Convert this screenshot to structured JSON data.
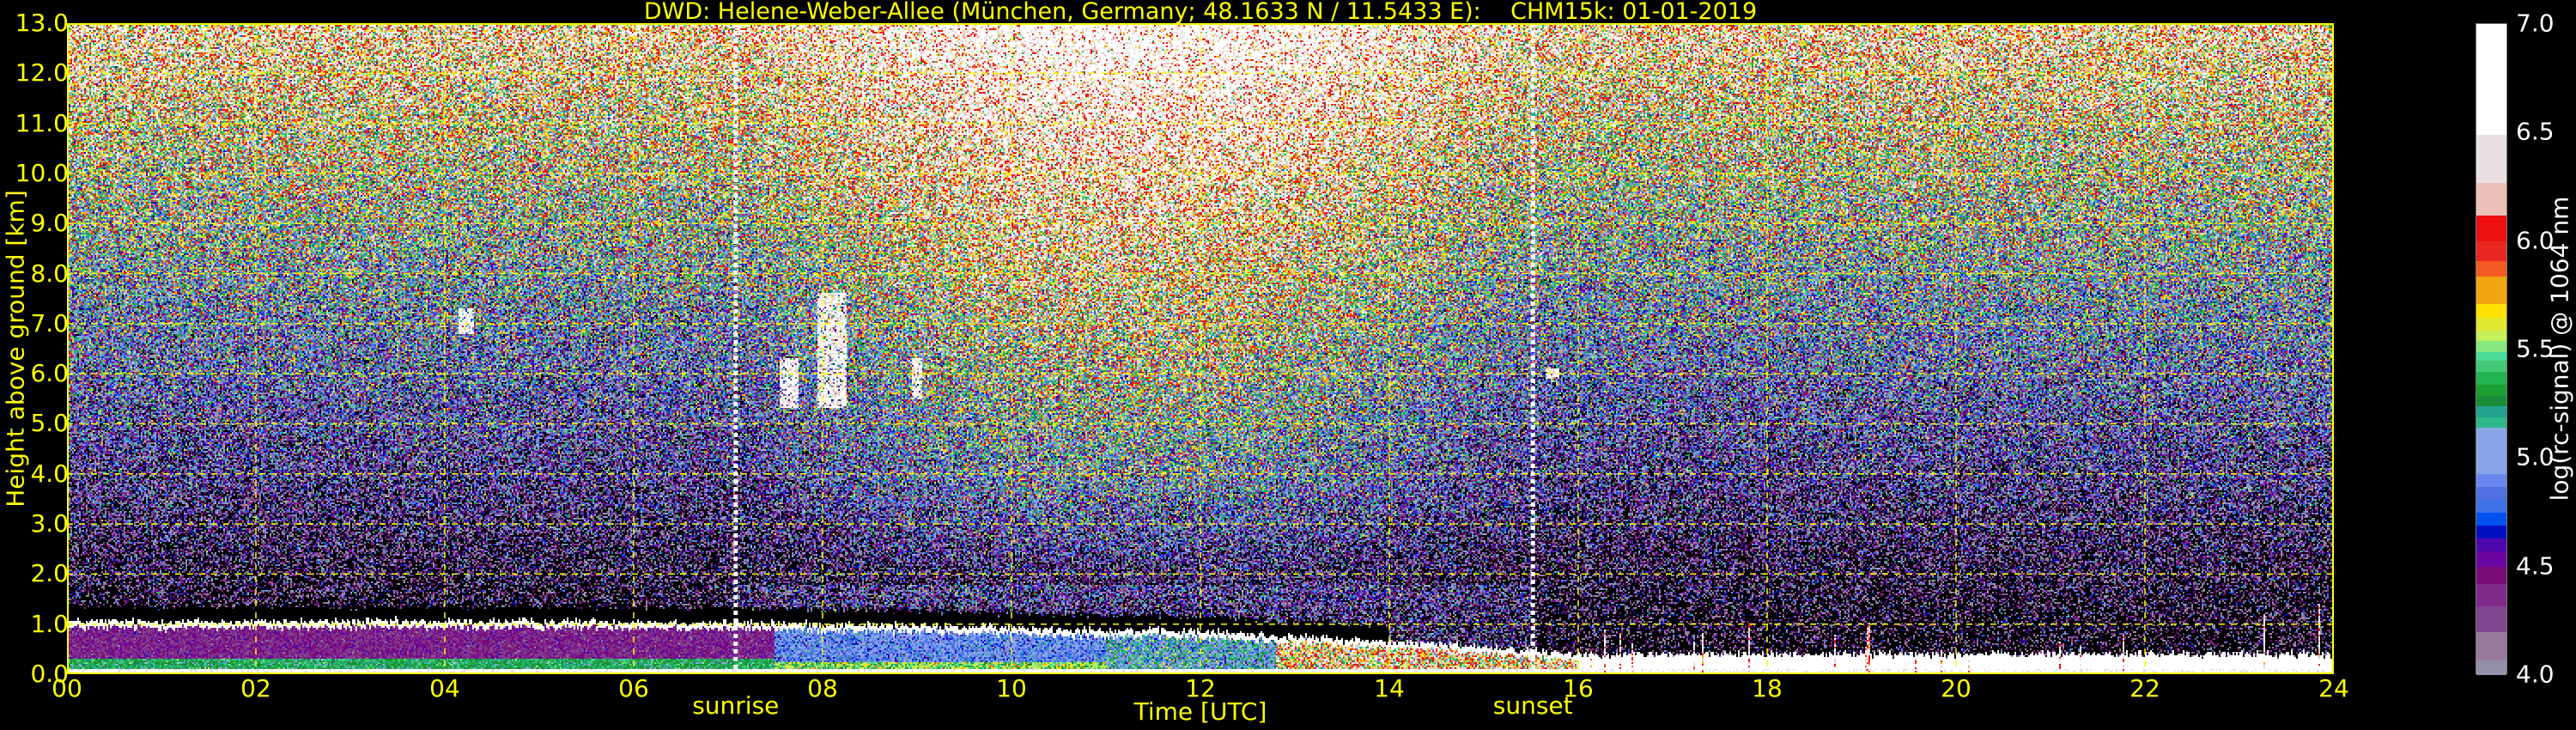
{
  "chart_data": {
    "type": "heatmap",
    "title": "DWD: Helene-Weber-Allee (München, Germany; 48.1633 N / 11.5433 E):    CHM15k: 01-01-2019",
    "xlabel": "Time [UTC]",
    "ylabel": "Height above ground [km]",
    "xlim": [
      0,
      24
    ],
    "ylim": [
      0,
      13
    ],
    "xticks": [
      "00",
      "02",
      "04",
      "06",
      "08",
      "10",
      "12",
      "14",
      "16",
      "18",
      "20",
      "22",
      "24"
    ],
    "xtick_values": [
      0,
      2,
      4,
      6,
      8,
      10,
      12,
      14,
      16,
      18,
      20,
      22,
      24
    ],
    "yticks": [
      "0.0",
      "1.0",
      "2.0",
      "3.0",
      "4.0",
      "5.0",
      "6.0",
      "7.0",
      "8.0",
      "9.0",
      "10.0",
      "11.0",
      "12.0",
      "13.0"
    ],
    "ytick_values": [
      0,
      1,
      2,
      3,
      4,
      5,
      6,
      7,
      8,
      9,
      10,
      11,
      12,
      13
    ],
    "grid": true,
    "events": [
      {
        "label": "sunrise",
        "time": 7.08
      },
      {
        "label": "sunset",
        "time": 15.52
      }
    ],
    "colorbar": {
      "label": "log(rc-signal) @ 1064 nm",
      "range": [
        4.0,
        7.0
      ],
      "ticks": [
        "4.0",
        "4.5",
        "5.0",
        "5.5",
        "6.0",
        "6.5",
        "7.0"
      ],
      "tick_values": [
        4.0,
        4.5,
        5.0,
        5.5,
        6.0,
        6.5,
        7.0
      ],
      "bins": [
        {
          "from": 4.0,
          "to": 4.07,
          "color": "#9490ac"
        },
        {
          "from": 4.07,
          "to": 4.2,
          "color": "#987a9c"
        },
        {
          "from": 4.2,
          "to": 4.32,
          "color": "#804690"
        },
        {
          "from": 4.32,
          "to": 4.42,
          "color": "#822a8a"
        },
        {
          "from": 4.42,
          "to": 4.5,
          "color": "#7a0c78"
        },
        {
          "from": 4.5,
          "to": 4.57,
          "color": "#6a06a0"
        },
        {
          "from": 4.57,
          "to": 4.63,
          "color": "#4c08ae"
        },
        {
          "from": 4.63,
          "to": 4.69,
          "color": "#0010c0"
        },
        {
          "from": 4.69,
          "to": 4.75,
          "color": "#0050f0"
        },
        {
          "from": 4.75,
          "to": 4.81,
          "color": "#3e70e8"
        },
        {
          "from": 4.81,
          "to": 4.87,
          "color": "#5070e2"
        },
        {
          "from": 4.87,
          "to": 4.93,
          "color": "#6a88ee"
        },
        {
          "from": 4.93,
          "to": 5.14,
          "color": "#8aa4e8"
        },
        {
          "from": 5.14,
          "to": 5.19,
          "color": "#2db88c"
        },
        {
          "from": 5.19,
          "to": 5.24,
          "color": "#22a090"
        },
        {
          "from": 5.24,
          "to": 5.29,
          "color": "#1a8a34"
        },
        {
          "from": 5.29,
          "to": 5.34,
          "color": "#1d9e30"
        },
        {
          "from": 5.34,
          "to": 5.4,
          "color": "#22b450"
        },
        {
          "from": 5.4,
          "to": 5.45,
          "color": "#44c878"
        },
        {
          "from": 5.45,
          "to": 5.49,
          "color": "#48dc98"
        },
        {
          "from": 5.49,
          "to": 5.54,
          "color": "#88e880"
        },
        {
          "from": 5.54,
          "to": 5.59,
          "color": "#c4f05a"
        },
        {
          "from": 5.59,
          "to": 5.65,
          "color": "#e0e830"
        },
        {
          "from": 5.65,
          "to": 5.71,
          "color": "#ffe000"
        },
        {
          "from": 5.71,
          "to": 5.84,
          "color": "#f0a610"
        },
        {
          "from": 5.84,
          "to": 5.91,
          "color": "#f45a24"
        },
        {
          "from": 5.91,
          "to": 6.0,
          "color": "#e82820"
        },
        {
          "from": 6.0,
          "to": 6.12,
          "color": "#ee1010"
        },
        {
          "from": 6.12,
          "to": 6.27,
          "color": "#ecc0b8"
        },
        {
          "from": 6.27,
          "to": 6.49,
          "color": "#e8e0e0"
        },
        {
          "from": 6.49,
          "to": 7.0,
          "color": "#ffffff"
        }
      ]
    },
    "features": {
      "boundary_layer_top_km": [
        [
          0,
          1.0
        ],
        [
          6,
          1.0
        ],
        [
          8,
          0.95
        ],
        [
          12,
          0.8
        ],
        [
          13.5,
          0.65
        ],
        [
          15,
          0.5
        ],
        [
          16,
          0.35
        ],
        [
          24,
          0.35
        ]
      ],
      "clouds": [
        {
          "t0": 4.15,
          "t1": 4.3,
          "h0": 6.8,
          "h1": 7.3
        },
        {
          "t0": 7.55,
          "t1": 7.75,
          "h0": 5.3,
          "h1": 6.3
        },
        {
          "t0": 7.95,
          "t1": 8.25,
          "h0": 5.3,
          "h1": 7.6
        },
        {
          "t0": 8.95,
          "t1": 9.05,
          "h0": 5.5,
          "h1": 6.3
        },
        {
          "t0": 15.65,
          "t1": 15.8,
          "h0": 5.9,
          "h1": 6.1
        }
      ]
    }
  }
}
